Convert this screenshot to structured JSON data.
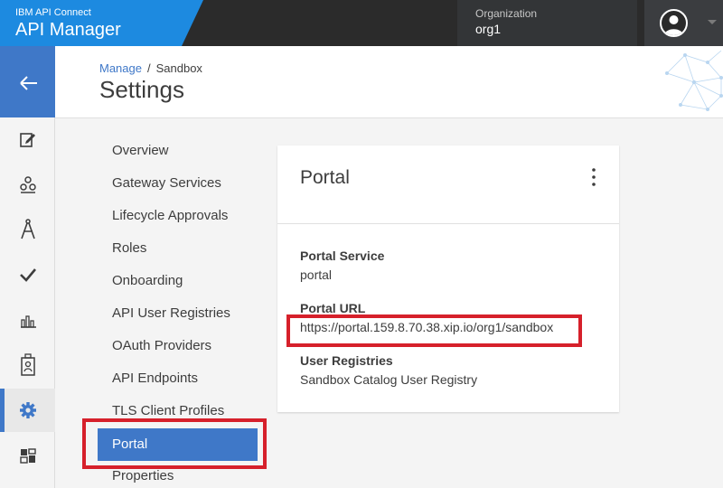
{
  "topbar": {
    "brand_sub": "IBM API Connect",
    "brand_title": "API Manager",
    "org_label": "Organization",
    "org_value": "org1"
  },
  "header": {
    "breadcrumb_link": "Manage",
    "breadcrumb_separator": "/",
    "breadcrumb_current": "Sandbox",
    "title": "Settings"
  },
  "rail": {
    "items": [
      "back-arrow-icon",
      "edit-icon",
      "community-icon",
      "compass-icon",
      "checkmark-icon",
      "analytics-icon",
      "id-badge-icon",
      "gear-icon",
      "dashboard-icon"
    ],
    "active": "gear-icon"
  },
  "nav": {
    "items": [
      "Overview",
      "Gateway Services",
      "Lifecycle Approvals",
      "Roles",
      "Onboarding",
      "API User Registries",
      "OAuth Providers",
      "API Endpoints",
      "TLS Client Profiles",
      "Portal",
      "Properties"
    ],
    "active": "Portal"
  },
  "card": {
    "title": "Portal",
    "portal_service_label": "Portal Service",
    "portal_service_value": "portal",
    "portal_url_label": "Portal URL",
    "portal_url_value": "https://portal.159.8.70.38.xip.io/org1/sandbox",
    "user_registries_label": "User Registries",
    "user_registries_value": "Sandbox Catalog User Registry"
  },
  "colors": {
    "brand_blue": "#1d8ae0",
    "active_blue": "#3f78c8",
    "highlight_red": "#d6202b",
    "topbar_dark": "#2b2b2b"
  }
}
